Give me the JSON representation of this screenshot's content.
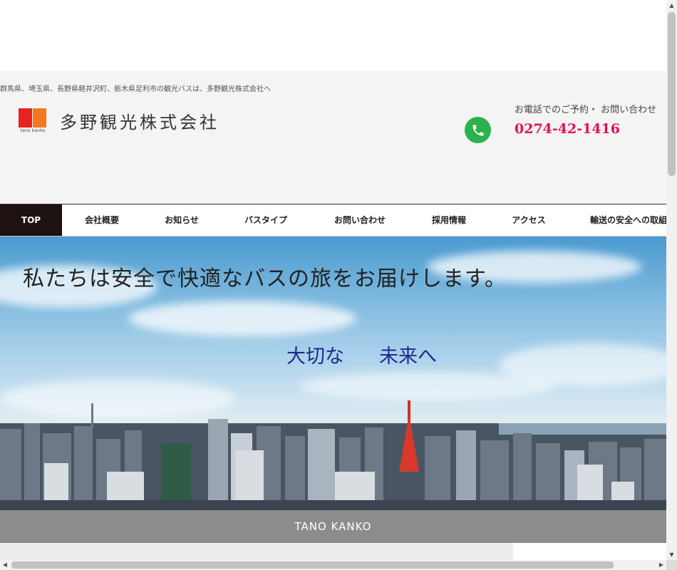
{
  "header": {
    "tagline": "群馬県、埼玉県、長野県軽井沢町、栃木県足利市の観光バスは、多野観光株式会社へ",
    "logo": {
      "name": "多野観光株式会社",
      "sub_text": "tano kanko",
      "colors": [
        "#e8221d",
        "#f5781f"
      ]
    },
    "contact": {
      "label": "お電話でのご予約・ お問い合わせ",
      "phone": "0274-42-1416",
      "icon": "phone-icon",
      "icon_color": "#2bb24c",
      "number_color": "#e0115f"
    }
  },
  "nav": {
    "items": [
      {
        "label": "TOP",
        "active": true
      },
      {
        "label": "会社概要",
        "active": false
      },
      {
        "label": "お知らせ",
        "active": false
      },
      {
        "label": "バスタイプ",
        "active": false
      },
      {
        "label": "お問い合わせ",
        "active": false
      },
      {
        "label": "採用情報",
        "active": false
      },
      {
        "label": "アクセス",
        "active": false
      },
      {
        "label": "輸送の安全への取組",
        "active": false
      }
    ]
  },
  "hero": {
    "slogan": "私たちは安全で快適なバスの旅をお届けします。",
    "phrase_1": "大切な",
    "phrase_2": "未来へ",
    "phrase_color": "#1c2a8c"
  },
  "brand_band": {
    "text": "TANO KANKO"
  },
  "scrollbars": {
    "up_icon": "▲",
    "down_icon": "▼",
    "left_icon": "◀",
    "right_icon": "▶"
  }
}
